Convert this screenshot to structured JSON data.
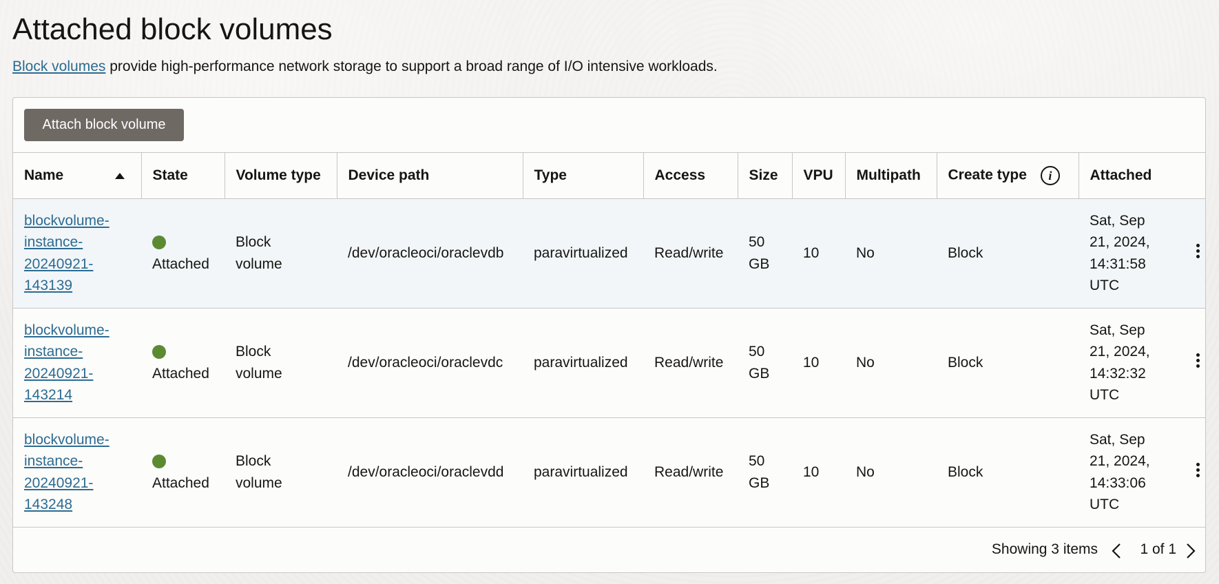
{
  "page": {
    "title": "Attached block volumes",
    "desc_link": "Block volumes",
    "desc_rest": " provide high-performance network storage to support a broad range of I/O intensive workloads."
  },
  "toolbar": {
    "attach_label": "Attach block volume"
  },
  "columns": [
    "Name",
    "State",
    "Volume type",
    "Device path",
    "Type",
    "Access",
    "Size",
    "VPU",
    "Multipath",
    "Create type",
    "Attached"
  ],
  "rows": [
    {
      "name_lines": [
        "blockvolume-",
        "instance-",
        "20240921-",
        "143139"
      ],
      "state": "Attached",
      "volume_type_lines": [
        "Block",
        "volume"
      ],
      "device_path": "/dev/oracleoci/oraclevdb",
      "type": "paravirtualized",
      "access": "Read/write",
      "size_lines": [
        "50",
        "GB"
      ],
      "vpu": "10",
      "multipath": "No",
      "create_type": "Block",
      "attached_lines": [
        "Sat, Sep",
        "21, 2024,",
        "14:31:58",
        "UTC"
      ]
    },
    {
      "name_lines": [
        "blockvolume-",
        "instance-",
        "20240921-",
        "143214"
      ],
      "state": "Attached",
      "volume_type_lines": [
        "Block",
        "volume"
      ],
      "device_path": "/dev/oracleoci/oraclevdc",
      "type": "paravirtualized",
      "access": "Read/write",
      "size_lines": [
        "50",
        "GB"
      ],
      "vpu": "10",
      "multipath": "No",
      "create_type": "Block",
      "attached_lines": [
        "Sat, Sep",
        "21, 2024,",
        "14:32:32",
        "UTC"
      ]
    },
    {
      "name_lines": [
        "blockvolume-",
        "instance-",
        "20240921-",
        "143248"
      ],
      "state": "Attached",
      "volume_type_lines": [
        "Block",
        "volume"
      ],
      "device_path": "/dev/oracleoci/oraclevdd",
      "type": "paravirtualized",
      "access": "Read/write",
      "size_lines": [
        "50",
        "GB"
      ],
      "vpu": "10",
      "multipath": "No",
      "create_type": "Block",
      "attached_lines": [
        "Sat, Sep",
        "21, 2024,",
        "14:33:06",
        "UTC"
      ]
    }
  ],
  "footer": {
    "showing": "Showing 3 items",
    "page": "1 of 1"
  },
  "colors": {
    "link": "#2c6b91",
    "status_ok": "#5c8a32",
    "button": "#6f6964"
  }
}
